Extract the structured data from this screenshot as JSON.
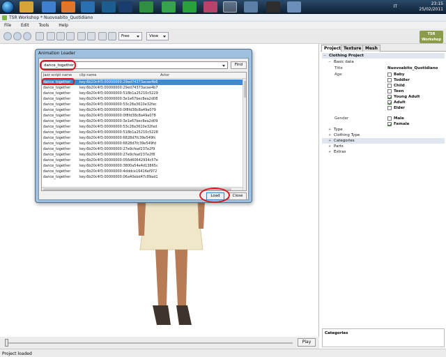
{
  "taskbar": {
    "language": "IT",
    "time": "23:15",
    "date": "25/02/2011"
  },
  "window": {
    "title": "TSR Workshop * Nuovoabito_Quotidiano"
  },
  "menu": [
    "File",
    "Edit",
    "Tools",
    "Help"
  ],
  "toolbar": {
    "camera_mode": "Free",
    "view_label": "View",
    "logo_text_1": "TSR",
    "logo_text_2": "Workshop"
  },
  "dialog": {
    "title": "Animation Loader",
    "search_value": "dance_together",
    "find_label": "Find",
    "columns": [
      "Jazz script name",
      "clip name",
      "Actor"
    ],
    "rows": [
      {
        "name": "dance_together",
        "clip": "key:6b20c4f3:00000000:29ed74373acae4b6",
        "selected": true
      },
      {
        "name": "dance_together",
        "clip": "key:6b20c4f3:00000000:29ed74373acae4b7",
        "selected": false
      },
      {
        "name": "dance_together",
        "clip": "key:6b20c4f3:00000000:518b1a25210c5229",
        "selected": false
      },
      {
        "name": "dance_together",
        "clip": "key:6b20c4f3:00000000:3e1e67bec8ea2d08",
        "selected": false
      },
      {
        "name": "dance_together",
        "clip": "key:6b20c4f3:00000000:53c28a3610e32fec",
        "selected": false
      },
      {
        "name": "dance_together",
        "clip": "key:6b20c4f3:00000000:0f8fd38c8a49a079",
        "selected": false
      },
      {
        "name": "dance_together",
        "clip": "key:6b20c4f3:00000000:0f8fd38c8a49a078",
        "selected": false
      },
      {
        "name": "dance_together",
        "clip": "key:6b20c4f3:00000000:3e1e67bec8ea2d09",
        "selected": false
      },
      {
        "name": "dance_together",
        "clip": "key:6b20c4f3:00000000:53c28a3610e32fed",
        "selected": false
      },
      {
        "name": "dance_together",
        "clip": "key:6b20c4f3:00000000:518b1a25210c5228",
        "selected": false
      },
      {
        "name": "dance_together",
        "clip": "key:6b20c4f3:00000000:6828d7fc39e549fc",
        "selected": false
      },
      {
        "name": "dance_together",
        "clip": "key:6b20c4f3:00000000:6828d7fc39e549fd",
        "selected": false
      },
      {
        "name": "dance_together",
        "clip": "key:6b20c4f3:00000000:27e9cfeaf237e2f9",
        "selected": false
      },
      {
        "name": "dance_together",
        "clip": "key:6b20c4f3:00000000:27e9cfeaf237e2f8",
        "selected": false
      },
      {
        "name": "dance_together",
        "clip": "key:6b20c4f3:00000000:056d60642934c57e",
        "selected": false
      },
      {
        "name": "dance_together",
        "clip": "key:6b20c4f3:00000000:3800a54e4d13865c",
        "selected": false
      },
      {
        "name": "dance_together",
        "clip": "key:6b20c4f3:00000000:4dddce16416ef972",
        "selected": false
      },
      {
        "name": "dance_together",
        "clip": "key:6b20c4f3:00000000:06a40ebd47c89ad1",
        "selected": false
      }
    ],
    "load_label": "Load",
    "close_label": "Close"
  },
  "right_panel": {
    "tabs": [
      "Project",
      "Texture",
      "Mesh"
    ],
    "section": "Clothing Project",
    "basic_data": "Basic data",
    "title_label": "Title",
    "title_value": "Nuovoabito_Quotidiano",
    "age_label": "Age",
    "ages": [
      {
        "label": "Baby",
        "checked": false
      },
      {
        "label": "Toddler",
        "checked": false
      },
      {
        "label": "Child",
        "checked": false
      },
      {
        "label": "Teen",
        "checked": false
      },
      {
        "label": "Young Adult",
        "checked": true
      },
      {
        "label": "Adult",
        "checked": true
      },
      {
        "label": "Elder",
        "checked": false
      }
    ],
    "gender_label": "Gender",
    "genders": [
      {
        "label": "Male",
        "checked": false
      },
      {
        "label": "Female",
        "checked": true
      }
    ],
    "groups": [
      "Type",
      "Clothing Type",
      "Categories",
      "Parts",
      "Extras"
    ],
    "categories_box": "Categories"
  },
  "timeline": {
    "play_label": "Play"
  },
  "status": "Project loaded"
}
